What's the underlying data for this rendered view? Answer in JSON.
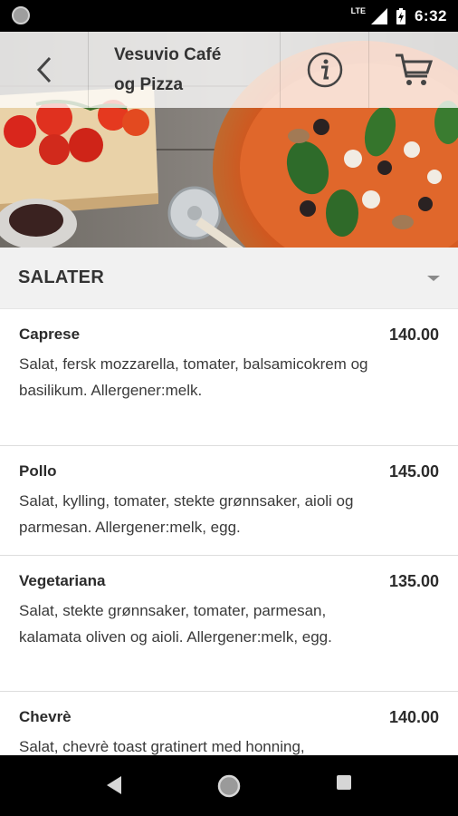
{
  "status_bar": {
    "network_label": "LTE",
    "time": "6:32",
    "icons": [
      "notification-icon",
      "signal-icon",
      "battery-icon"
    ]
  },
  "app_bar": {
    "title": "Vesuvio Café\nog Pizza",
    "back_icon": "chevron-left-icon",
    "info_icon": "info-icon",
    "cart_icon": "cart-icon"
  },
  "category": {
    "title": "SALATER",
    "expand_icon": "caret-down-icon"
  },
  "menu_items": [
    {
      "name": "Caprese",
      "price": "140.00",
      "description": "Salat, fersk mozzarella, tomater, balsamicokrem og basilikum. Allergener:melk."
    },
    {
      "name": "Pollo",
      "price": "145.00",
      "description": "Salat, kylling, tomater, stekte grønnsaker, aioli og parmesan. Allergener:melk, egg."
    },
    {
      "name": "Vegetariana",
      "price": "135.00",
      "description": "Salat, stekte grønnsaker, tomater, parmesan, kalamata oliven og aioli. Allergener:melk, egg."
    },
    {
      "name": "Chevrè",
      "price": "140.00",
      "description": "Salat, chevrè toast gratinert med honning,"
    }
  ],
  "nav_bar": {
    "icons": [
      "back-triangle-icon",
      "home-circle-icon",
      "recents-square-icon"
    ]
  },
  "colors": {
    "status_bar": "#000000",
    "category_bg": "#f1f1f1",
    "text": "#2b2b2b"
  }
}
